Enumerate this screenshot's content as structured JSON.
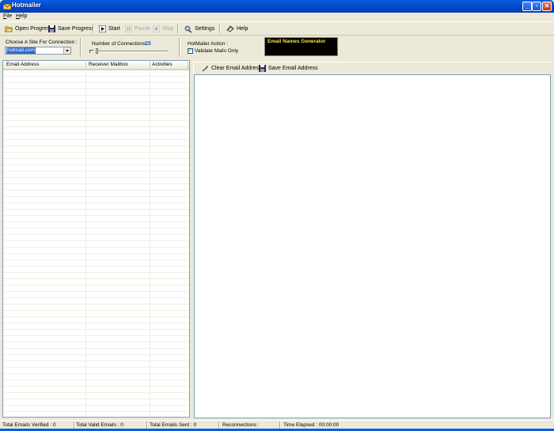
{
  "window": {
    "title": "Hotmailer",
    "controls": [
      "minimize-icon",
      "maximize-icon",
      "close-icon"
    ]
  },
  "menu": {
    "items": [
      {
        "label": "File",
        "access_key": "F"
      },
      {
        "label": "Help",
        "access_key": "H"
      }
    ]
  },
  "toolbar": {
    "open_progress": "Open Progress",
    "save_progress": "Save Progress",
    "start": "Start",
    "pause": "Pause",
    "stop": "Stop",
    "settings": "Settings",
    "help": "Help"
  },
  "options": {
    "site_label": "Choose A Site For Connection :",
    "site_value": "hotmail.com",
    "connections_label": "Number of Connections :",
    "connections_value": "15",
    "action_label": "HotMailer Action :",
    "validate_label": "Validate Mails Only",
    "validate_checked": true,
    "generator_label": "Email Names Generator"
  },
  "list": {
    "columns": [
      "Email Address",
      "Receiver Mailbox",
      "Activities"
    ],
    "rows": []
  },
  "right_toolbar": {
    "clear": "Clear Email Address",
    "save": "Save Email Address"
  },
  "status": {
    "verified": "Total Emails Verified : 0",
    "valid": "Total Valid Emails : 0",
    "sent": "Total Emails Sent : 0",
    "reconnections": "Reconnections :",
    "elapsed": "Time Elapsed : 00:00:00"
  },
  "colors": {
    "titlebar": "#0a5de0",
    "window_bg": "#ece9d8",
    "connections_accent": "#1060d8",
    "generator_bg": "#000000",
    "generator_text": "#f5e342"
  }
}
